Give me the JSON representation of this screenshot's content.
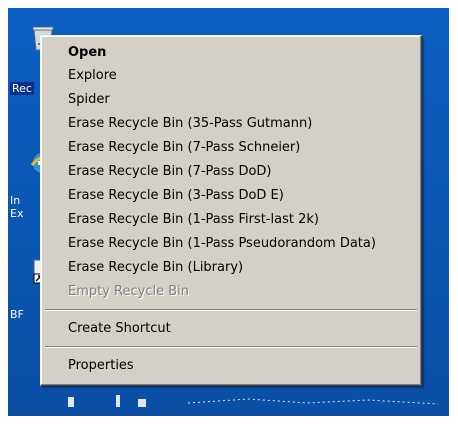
{
  "colors": {
    "desktop": "#0a59b8",
    "menu_background": "#d4d0c8",
    "menu_text": "#000000",
    "menu_disabled_text": "#808080",
    "selection": "#0b2f86"
  },
  "desktop": {
    "icons": [
      {
        "label": "Rec",
        "icon": "recycle-bin-icon"
      },
      {
        "label_line1": "In",
        "label_line2": "Ex",
        "icon": "internet-explorer-icon"
      },
      {
        "label": "BF",
        "icon": "shortcut-icon"
      }
    ]
  },
  "context_menu": {
    "items": [
      {
        "label": "Open",
        "bold": true,
        "enabled": true
      },
      {
        "label": "Explore",
        "enabled": true
      },
      {
        "label": "Spider",
        "enabled": true
      },
      {
        "label": "Erase Recycle Bin (35-Pass Gutmann)",
        "enabled": true
      },
      {
        "label": "Erase Recycle Bin (7-Pass Schneier)",
        "enabled": true
      },
      {
        "label": "Erase Recycle Bin (7-Pass DoD)",
        "enabled": true
      },
      {
        "label": "Erase Recycle Bin (3-Pass DoD E)",
        "enabled": true
      },
      {
        "label": "Erase Recycle Bin (1-Pass First-last 2k)",
        "enabled": true
      },
      {
        "label": "Erase Recycle Bin (1-Pass Pseudorandom Data)",
        "enabled": true
      },
      {
        "label": "Erase Recycle Bin (Library)",
        "enabled": true
      },
      {
        "label": "Empty Recycle Bin",
        "enabled": false
      },
      {
        "label": "Create Shortcut",
        "enabled": true
      },
      {
        "label": "Properties",
        "enabled": true
      }
    ]
  }
}
